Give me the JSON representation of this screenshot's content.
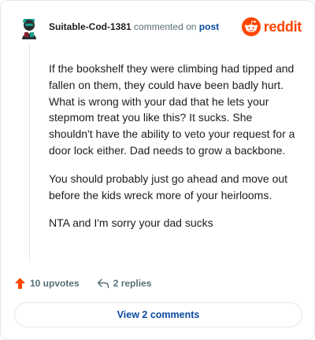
{
  "comment": {
    "username": "Suitable-Cod-1381",
    "commented_text": "commented on",
    "post_link": "post",
    "brand": "reddit",
    "paragraphs": [
      "If the bookshelf they were climbing had tipped and fallen on them, they could have been badly hurt. What is wrong with your dad that he lets your stepmom treat you like this? It sucks. She shouldn't have the ability to veto your request for a door lock either. Dad needs to grow a backbone.",
      "You should probably just go ahead and move out before the kids wreck more of your heirlooms.",
      "NTA and I'm sorry your dad sucks"
    ],
    "upvotes_label": "10 upvotes",
    "replies_label": "2 replies",
    "view_comments_label": "View 2 comments"
  },
  "colors": {
    "reddit_orange": "#ff4500",
    "link_blue": "#0a4a9e",
    "muted_gray": "#576f76",
    "avatar_teal": "#1a9e8f"
  },
  "icons": {
    "upvote": "upvote-arrow-icon",
    "reply": "reply-arrow-icon",
    "reddit_logo": "reddit-snoo-icon",
    "avatar": "user-avatar"
  }
}
